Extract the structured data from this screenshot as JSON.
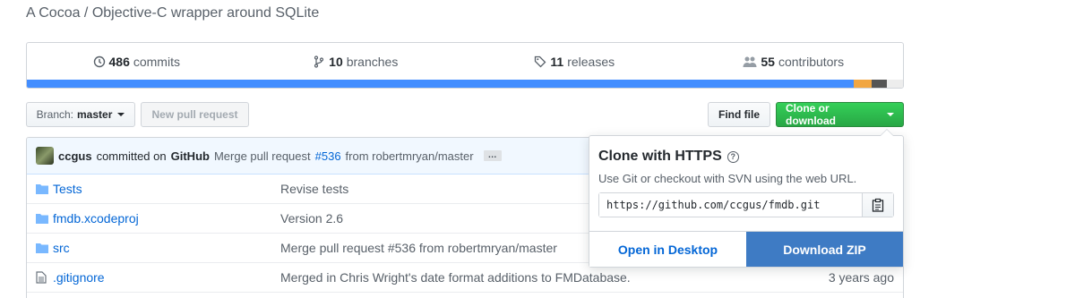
{
  "repo": {
    "description": "A Cocoa / Objective-C wrapper around SQLite"
  },
  "summary": {
    "commits_count": "486",
    "commits_label": "commits",
    "branches_count": "10",
    "branches_label": "branches",
    "releases_count": "11",
    "releases_label": "releases",
    "contributors_count": "55",
    "contributors_label": "contributors"
  },
  "language_bar": [
    {
      "color": "#438eff",
      "percent": 94.4
    },
    {
      "color": "#f1a642",
      "percent": 2.0
    },
    {
      "color": "#555555",
      "percent": 1.8
    },
    {
      "color": "#ededed",
      "percent": 1.8
    }
  ],
  "toolbar": {
    "branch_prefix": "Branch:",
    "branch_name": "master",
    "new_pull_request": "New pull request",
    "find_file": "Find file",
    "clone_or_download": "Clone or download"
  },
  "commit": {
    "user": "ccgus",
    "committed_on": "committed on",
    "platform": "GitHub",
    "message_prefix": "Merge pull request",
    "pr_link": "#536",
    "message_suffix": "from robertmryan/master",
    "ellipsis": "…"
  },
  "files": [
    {
      "type": "folder",
      "name": "Tests",
      "message": "Revise tests",
      "age": ""
    },
    {
      "type": "folder",
      "name": "fmdb.xcodeproj",
      "message": "Version 2.6",
      "age": ""
    },
    {
      "type": "folder",
      "name": "src",
      "message": "Merge pull request #536 from robertmryan/master",
      "age": ""
    },
    {
      "type": "file",
      "name": ".gitignore",
      "message": "Merged in Chris Wright's date format additions to FMDatabase.",
      "age": "3 years ago"
    }
  ],
  "clone_dropdown": {
    "title": "Clone with HTTPS",
    "help": "?",
    "subtitle": "Use Git or checkout with SVN using the web URL.",
    "url": "https://github.com/ccgus/fmdb.git",
    "open_desktop": "Open in Desktop",
    "download_zip": "Download ZIP"
  },
  "colors": {
    "link": "#0366d6",
    "green_button": "#28a745",
    "download_blue": "#3e7bc4"
  }
}
